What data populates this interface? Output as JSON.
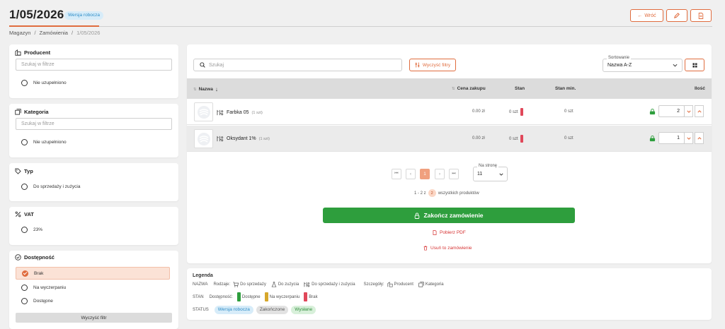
{
  "header": {
    "title": "1/05/2026",
    "status_badge": "Wersja robocza",
    "back_label": "Wróć"
  },
  "breadcrumb": {
    "items": [
      "Magazyn",
      "Zamówienia",
      "1/05/2026"
    ]
  },
  "filters": {
    "producent": {
      "title": "Producent",
      "placeholder": "Szukaj w filtrze",
      "options": [
        "Nie uzupełniono"
      ]
    },
    "kategoria": {
      "title": "Kategoria",
      "placeholder": "Szukaj w filtrze",
      "options": [
        "Nie uzupełniono"
      ]
    },
    "typ": {
      "title": "Typ",
      "options": [
        "Do sprzedaży i zużycia"
      ]
    },
    "vat": {
      "title": "VAT",
      "options": [
        "23%"
      ]
    },
    "dostepnosc": {
      "title": "Dostępność",
      "options": [
        "Brak",
        "Na wyczerpaniu",
        "Dostępne"
      ],
      "selected": "Brak"
    },
    "clear_label": "Wyczyść filtr"
  },
  "toolbar": {
    "search_placeholder": "Szukaj",
    "clear_filters_label": "Wyczyść filtry",
    "sort_label": "Sortowanie",
    "sort_value": "Nazwa A-Z"
  },
  "table": {
    "columns": [
      "Nazwa",
      "Cena zakupu",
      "Stan",
      "Stan min.",
      "Ilość"
    ],
    "rows": [
      {
        "name": "Farbka 05",
        "count": "(1 szt)",
        "price": "0.00 zł",
        "stock": "0 szt",
        "stock_min": "0 szt",
        "qty": "2"
      },
      {
        "name": "Oksydant 1%",
        "count": "(1 szt)",
        "price": "0.00 zł",
        "stock": "0 szt",
        "stock_min": "0 szt",
        "qty": "1"
      }
    ]
  },
  "pagination": {
    "current_page": "1",
    "per_page_label": "Na stronę",
    "per_page_value": "11",
    "summary_prefix": "1 - 2 z",
    "total": "2",
    "summary_suffix": "wszystkich produktów"
  },
  "actions": {
    "finish_label": "Zakończ zamówienie",
    "pdf_label": "Pobierz PDF",
    "delete_label": "Usuń to zamówienie"
  },
  "legend": {
    "title": "Legenda",
    "nazwa_key": "NAZWA",
    "rodzaje_label": "Rodzaje:",
    "rodzaje": [
      "Do sprzedaży",
      "Do zużycia",
      "Do sprzedaży i zużycia"
    ],
    "szczegoly_label": "Szczegóły:",
    "szczegoly": [
      "Producent",
      "Kategoria"
    ],
    "stan_key": "STAN",
    "dostepnosc_label": "Dostępność:",
    "stan_items": [
      {
        "label": "Dostępne",
        "color": "#2e9e3d"
      },
      {
        "label": "Na wyczerpaniu",
        "color": "#d6a72b"
      },
      {
        "label": "Brak",
        "color": "#e0485a"
      }
    ],
    "status_key": "STATUS",
    "statuses": [
      "Wersja robocza",
      "Zakończone",
      "Wysłane"
    ]
  },
  "colors": {
    "accent": "#e06c3e",
    "success": "#2e9e3d",
    "danger": "#d63333"
  }
}
